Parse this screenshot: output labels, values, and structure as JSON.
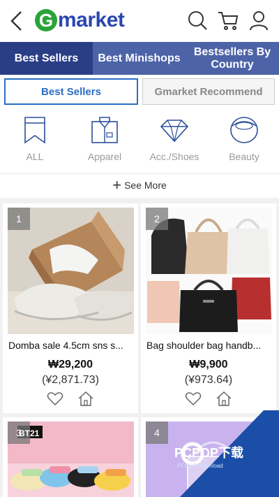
{
  "header": {
    "logo_letter": "G",
    "logo_text": "market"
  },
  "tabs": [
    {
      "label": "Best Sellers",
      "active": true
    },
    {
      "label": "Best Minishops",
      "active": false
    },
    {
      "label": "Bestsellers By Country",
      "active": false
    }
  ],
  "subtabs": [
    {
      "label": "Best Sellers",
      "active": true
    },
    {
      "label": "Gmarket Recommend",
      "active": false
    }
  ],
  "categories": [
    {
      "label": "ALL",
      "icon": "bookmark-icon"
    },
    {
      "label": "Apparel",
      "icon": "shirt-icon"
    },
    {
      "label": "Acc./Shoes",
      "icon": "diamond-icon"
    },
    {
      "label": "Beauty",
      "icon": "compact-icon"
    }
  ],
  "see_more": "See More",
  "products": [
    {
      "rank": "1",
      "name": "Domba sale 4.5cm sns s...",
      "price": "₩29,200",
      "price_cny": "(¥2,871.73)"
    },
    {
      "rank": "2",
      "name": "Bag shoulder bag handb...",
      "price": "₩9,900",
      "price_cny": "(¥973.64)"
    },
    {
      "rank": "3",
      "badge": "BT21"
    },
    {
      "rank": "4"
    }
  ],
  "watermark": {
    "text": "PCPOP下载",
    "sub": "PCPOP Download"
  },
  "colors": {
    "brand_blue": "#2b46b0",
    "tab_bg": "#4d63a8",
    "tab_active": "#2a3e86",
    "accent": "#2a6ec4",
    "logo_green": "#29a339"
  }
}
